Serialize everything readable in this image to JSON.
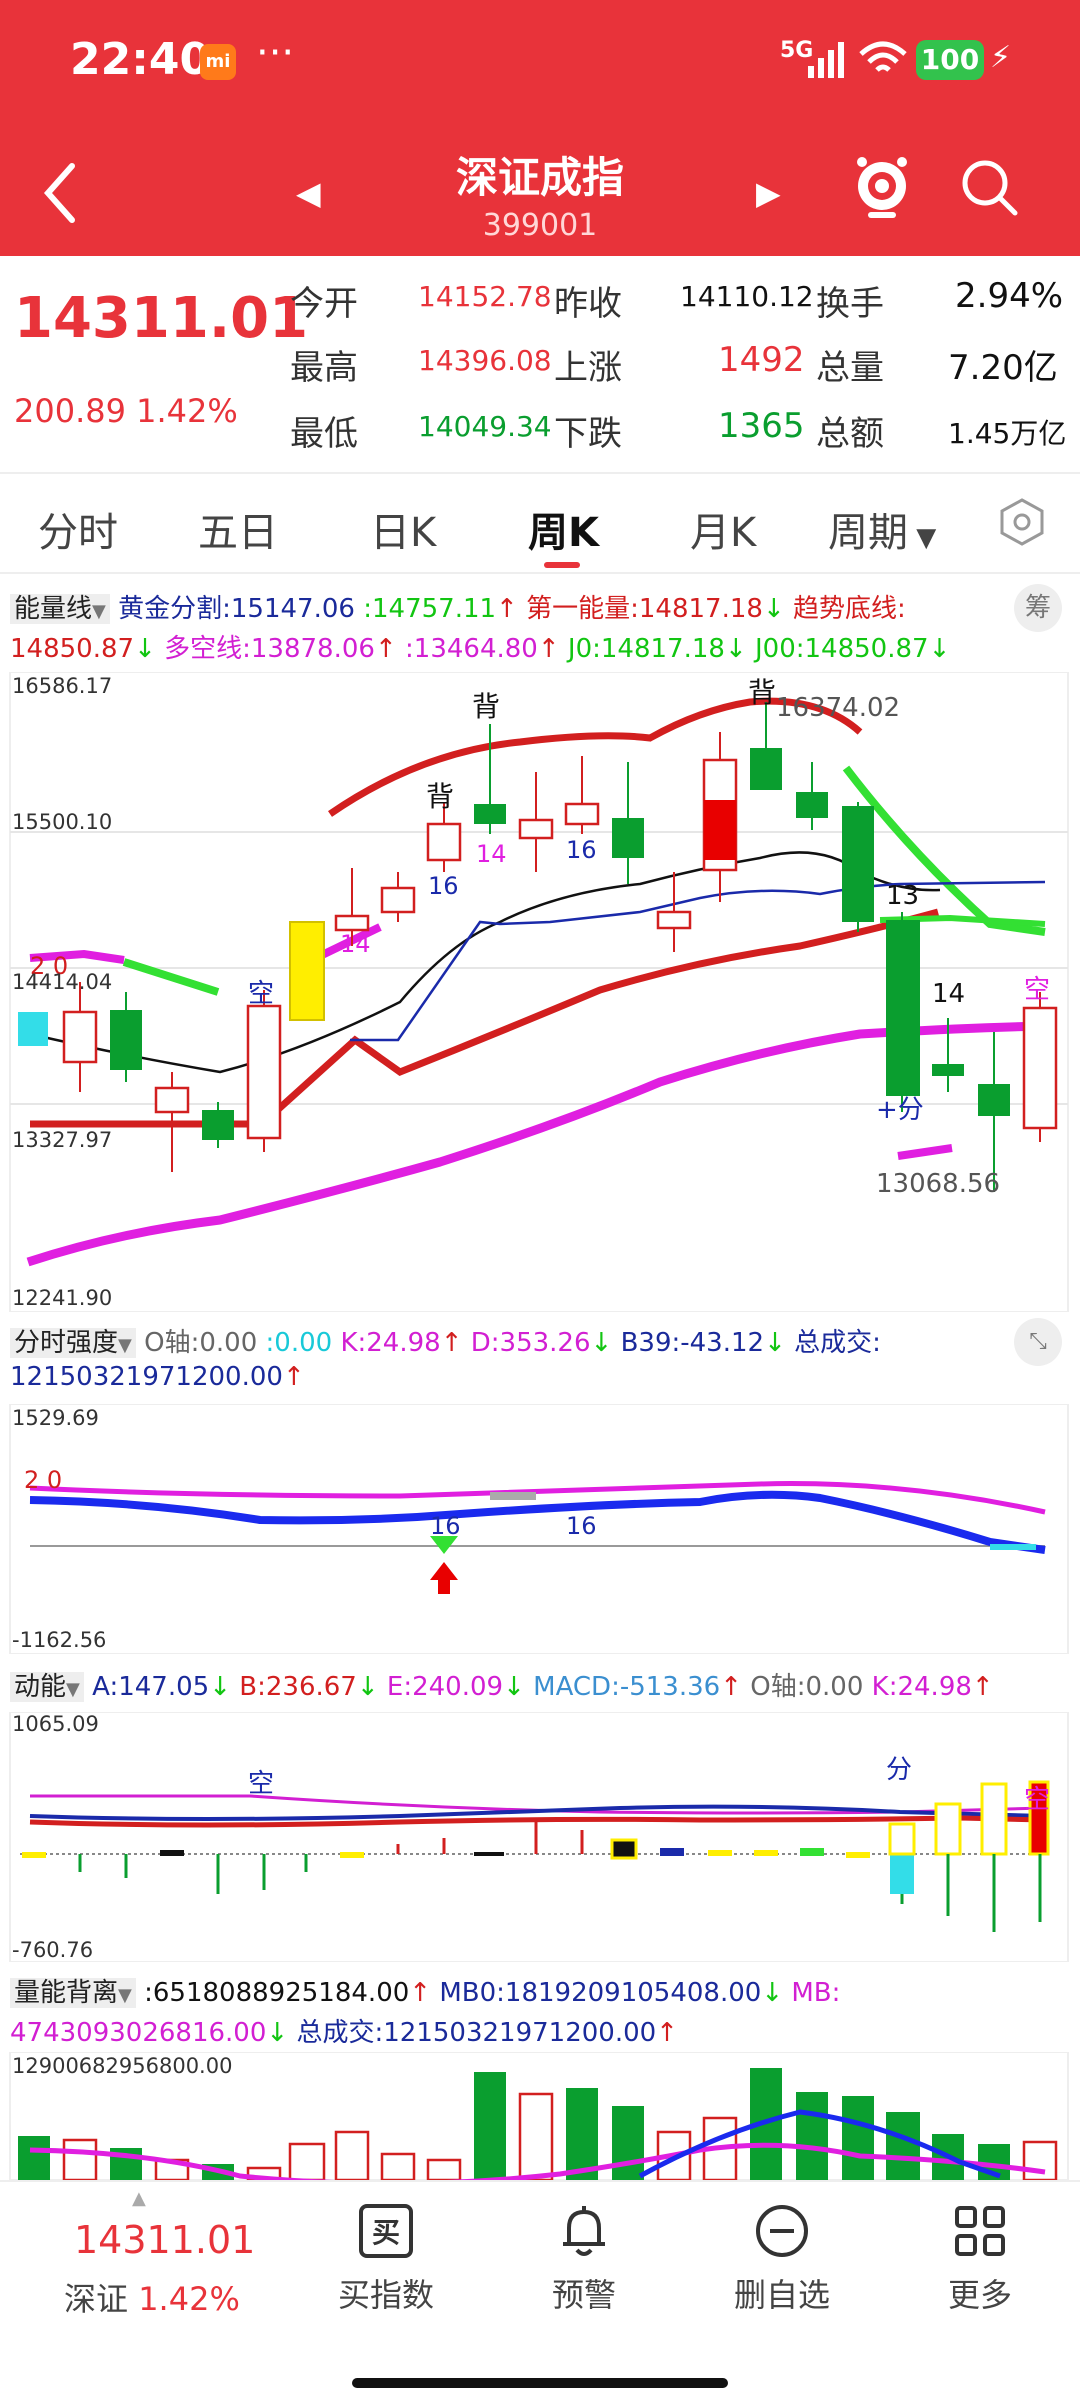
{
  "status": {
    "time": "22:40",
    "mi": "mi",
    "dots": "···",
    "network": "5G",
    "battery": "100"
  },
  "nav": {
    "title": "深证成指",
    "code": "399001"
  },
  "quote": {
    "price": "14311.01",
    "change": "200.89",
    "change_pct": "1.42%",
    "rows": [
      {
        "l1": "今开",
        "v1": "14152.78",
        "l2": "昨收",
        "v2": "14110.12",
        "l3": "换手",
        "v3": "2.94%"
      },
      {
        "l1": "最高",
        "v1": "14396.08",
        "l2": "上涨",
        "v2": "1492",
        "l3": "总量",
        "v3": "7.20亿"
      },
      {
        "l1": "最低",
        "v1": "14049.34",
        "l2": "下跌",
        "v2": "1365",
        "l3": "总额",
        "v3": "1.45万亿"
      }
    ]
  },
  "tabs": [
    "分时",
    "五日",
    "日K",
    "周K",
    "月K",
    "周期"
  ],
  "main_indicator": {
    "name": "能量线",
    "l1": [
      "黄金分割:15147.06",
      ":14757.11",
      "第一能量:14817.18",
      "趋势底线:"
    ],
    "l2": [
      "14850.87",
      "多空线:13878.06",
      ":13464.80",
      "J0:14817.18",
      "J00:14850.87"
    ],
    "btn": "筹",
    "axis": [
      "16586.17",
      "15500.10",
      "14414.04",
      "13327.97",
      "12241.90"
    ]
  },
  "labels": {
    "bei": "背",
    "kong": "空",
    "n14": "14",
    "n16": "16",
    "n13": "13",
    "fen": "+分",
    "hi": "16374.02",
    "lo": "13068.56",
    "twozero": "2 0",
    "twozeroblue": "2 0",
    "kong2": "空",
    "fen2": "分",
    "kong3": "空",
    "k16a": "16",
    "k16b": "16"
  },
  "ind2": {
    "name": "分时强度",
    "l1": [
      "O轴:0.00",
      ":0.00",
      "K:24.98",
      "D:353.26",
      "B39:-43.12",
      "总成交:"
    ],
    "l2": "12150321971200.00",
    "axis": [
      "1529.69",
      "-1162.56"
    ]
  },
  "ind3": {
    "name": "动能",
    "l1": [
      "A:147.05",
      "B:236.67",
      "E:240.09",
      "MACD:-513.36",
      "O轴:0.00",
      "K:24.98"
    ],
    "axis": [
      "1065.09",
      "-760.76"
    ]
  },
  "ind4": {
    "name": "量能背离",
    "l1": [
      ":6518088925184.00",
      "MB0:1819209105408.00",
      "MB:"
    ],
    "l2": [
      "4743093026816.00",
      "总成交:12150321971200.00"
    ],
    "axis": [
      "12900682956800.00"
    ]
  },
  "bottom": {
    "price": "14311.01",
    "name": "深证",
    "pct": "1.42%",
    "items": [
      "买指数",
      "预警",
      "删自选",
      "更多"
    ],
    "buy_glyph": "买"
  },
  "colors": {
    "red": "#e8333a",
    "green": "#0a9e2f"
  }
}
